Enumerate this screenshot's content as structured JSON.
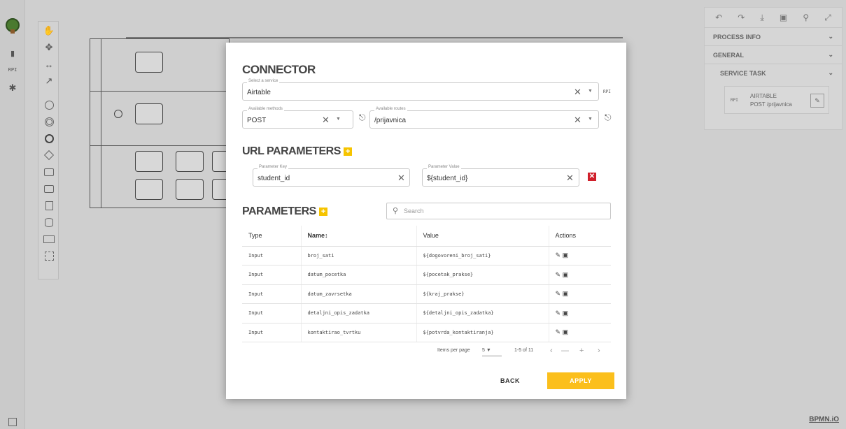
{
  "canvas": {
    "left_icons": [
      "file-icon",
      "RPI",
      "person-icon"
    ],
    "watermark": "BPMN.iO"
  },
  "properties_panel": {
    "sections": [
      "PROCESS INFO",
      "GENERAL",
      "SERVICE TASK"
    ],
    "service_card": {
      "rpi": "RPI",
      "service": "AIRTABLE",
      "route": "POST /prijavnica"
    }
  },
  "dialog": {
    "title": "CONNECTOR",
    "service": {
      "legend": "Select a service",
      "value": "Airtable",
      "tag": "RPI"
    },
    "method": {
      "legend": "Available methods",
      "value": "POST"
    },
    "route": {
      "legend": "Available routes",
      "value": "/prijavnica"
    },
    "url_params_title": "URL PARAMETERS",
    "url_param": {
      "key_legend": "Parameter Key",
      "key_value": "student_id",
      "value_legend": "Parameter Value",
      "value_value": "${student_id}"
    },
    "params_title": "PARAMETERS",
    "search_placeholder": "Search",
    "table": {
      "columns": [
        "Type",
        "Name↕",
        "Value",
        "Actions"
      ],
      "rows": [
        [
          "Input",
          "broj_sati",
          "${dogovoreni_broj_sati}"
        ],
        [
          "Input",
          "datum_pocetka",
          "${pocetak_prakse}"
        ],
        [
          "Input",
          "datum_zavrsetka",
          "${kraj_prakse}"
        ],
        [
          "Input",
          "detaljni_opis_zadatka",
          "${detaljni_opis_zadatka}"
        ],
        [
          "Input",
          "kontaktirao_tvrtku",
          "${potvrda_kontaktiranja}"
        ]
      ]
    },
    "pagination": {
      "items_label": "Items per page",
      "per_page": "5",
      "range": "1-5 of 11"
    },
    "back_label": "BACK",
    "apply_label": "APPLY"
  }
}
